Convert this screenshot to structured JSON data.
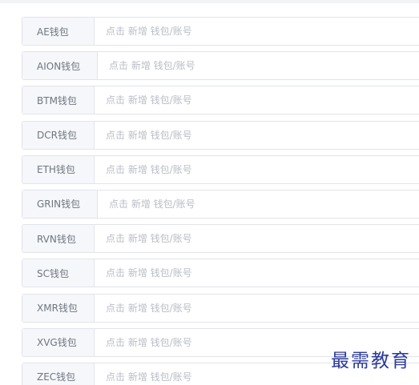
{
  "wallets": [
    {
      "label": "AE钱包",
      "placeholder": "点击 新增 钱包/账号"
    },
    {
      "label": "AION钱包",
      "placeholder": "点击 新增 钱包/账号"
    },
    {
      "label": "BTM钱包",
      "placeholder": "点击 新增 钱包/账号"
    },
    {
      "label": "DCR钱包",
      "placeholder": "点击 新增 钱包/账号"
    },
    {
      "label": "ETH钱包",
      "placeholder": "点击 新增 钱包/账号"
    },
    {
      "label": "GRIN钱包",
      "placeholder": "点击 新增 钱包/账号"
    },
    {
      "label": "RVN钱包",
      "placeholder": "点击 新增 钱包/账号"
    },
    {
      "label": "SC钱包",
      "placeholder": "点击 新增 钱包/账号"
    },
    {
      "label": "XMR钱包",
      "placeholder": "点击 新增 钱包/账号"
    },
    {
      "label": "XVG钱包",
      "placeholder": "点击 新增 钱包/账号"
    },
    {
      "label": "ZEC钱包",
      "placeholder": "点击 新增 钱包/账号"
    }
  ],
  "watermark": "最需教育",
  "colors": {
    "label_bg": "#f5f7fa",
    "border": "#e1e4ea",
    "label_text": "#707680",
    "placeholder_text": "#b9bdc6",
    "watermark": "#2b3a9a"
  }
}
